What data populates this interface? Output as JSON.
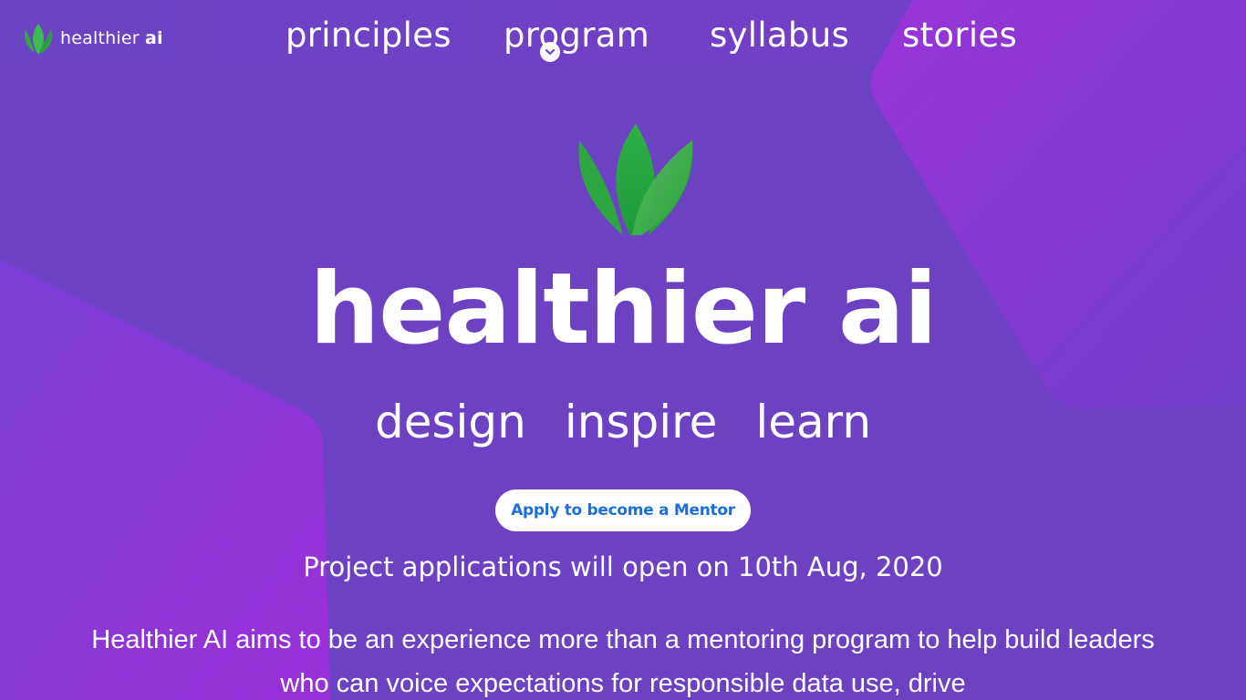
{
  "brand": {
    "name": "healthier",
    "suffix": "ai"
  },
  "nav": {
    "items": [
      {
        "label": "principles"
      },
      {
        "label": "program"
      },
      {
        "label": "syllabus"
      },
      {
        "label": "stories"
      }
    ]
  },
  "hero": {
    "title": "healthier ai",
    "tagline": [
      "design",
      "inspire",
      "learn"
    ],
    "cta_label": "Apply to become a Mentor",
    "announcement": "Project applications will open on 10th Aug, 2020",
    "intro": "Healthier AI aims to be an experience more than a mentoring program to help build leaders who can voice expectations for responsible data use, drive"
  },
  "icons": {
    "logo": "leaf-logo-icon",
    "dropdown": "chevron-down-icon"
  },
  "colors": {
    "background": "#6c42c2",
    "accent_shape": "#9a2fd8",
    "leaf_green": "#3aab46",
    "cta_text": "#1a6fd8",
    "text": "#ffffff"
  }
}
